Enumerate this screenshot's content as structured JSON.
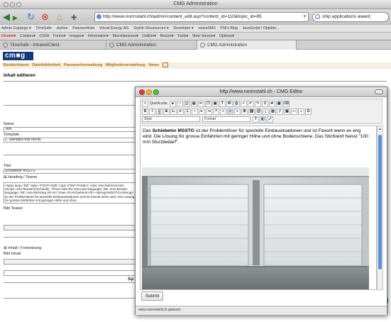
{
  "browser": {
    "title": "CMG Administration",
    "url": "http://www.normstahl.ch/admin/content_edit.asp?content_id=110&topic_id=85",
    "search_text": "ship applications award"
  },
  "bookmarks": [
    "Admin Zugänge ▾",
    "TimeSafe",
    "skyline",
    "Passwortliste",
    "Visual Energy AG",
    "Grphic Ressourcen ▾",
    "Developer ▾",
    "swissSMS",
    "Phil's Blog",
    "JavaScript / Objekte..."
  ],
  "devtools": [
    "Disable▾",
    "Cookies▾",
    "CSS▾",
    "Forms▾",
    "Images▾",
    "Information▾",
    "Miscellaneous▾",
    "Outline▾",
    "Resize▾",
    "Tools▾",
    "View Source▾",
    "Options▾"
  ],
  "tabs": [
    {
      "label": "TimeSafe - IntranetClient"
    },
    {
      "label": "CMG Administration"
    },
    {
      "label": "CMG Administration"
    }
  ],
  "cms": {
    "logo": "cm■g",
    "nav": [
      "Strukturbaum",
      "Dateibibliothek",
      "Passwortverwaltung",
      "Mitgliederverwaltung",
      "News"
    ],
    "section_title": "Inhalt editieren",
    "fields": {
      "name_label": "Name",
      "name_value": "Text",
      "template_label": "Template",
      "template_value": "1. Standard Bild rechts",
      "titel_label": "Titel",
      "titel_value": "Schiebetor MSSTG",
      "heading_label": "⊞ Heading / Teaser",
      "teaser_html": "<span lang=\"DE\" style=\"FONT-SIZE: 11pt; FONT-FAMILY: Arial; mso-bidi-font-size: 10.0pt; mso-fareast-font-family: 'Times New Ro mso-ansi-language: DE; mso-fareast-language: DE; mso-bidi-lang AR-SA\">Das <b>Schiebetor</b> <strong>MSSTG</strong> ist der Problemlöser für spezielle Einbausituationen und ist Favorit wenn wird. Die Lösung für grosse Einfahrten mit geringer Höhe und ohne",
      "bild_teaser_label": "Bild Teaser",
      "inhalt_label": "⊞ Inhalt / Fortsetzung",
      "bild_inhalt_label": "Bild Inhalt",
      "partial_label_1": "Sp",
      "partial_label_2": "g"
    }
  },
  "editor_popup": {
    "title": "http://www.normstahl.ch - CMG Editor",
    "toolbar_quellcode": "Quellcode",
    "style_select": "Style",
    "format_select": "Format",
    "content_bold": "Schiebetor MSSTG",
    "content_before": "Das ",
    "content_after": " ist der Problemlöser für spezielle Einbausituationen und ist Favorit wenn es eng wird. Die Lösung für grosse Einfahrten mit geringer Höhe und ohne Bodenschiene. Das Stichwort heisst \"100 mm Sturzbedarf\".",
    "submit_label": "Submit",
    "status_text": "www.normstahl.ch gelesen"
  }
}
